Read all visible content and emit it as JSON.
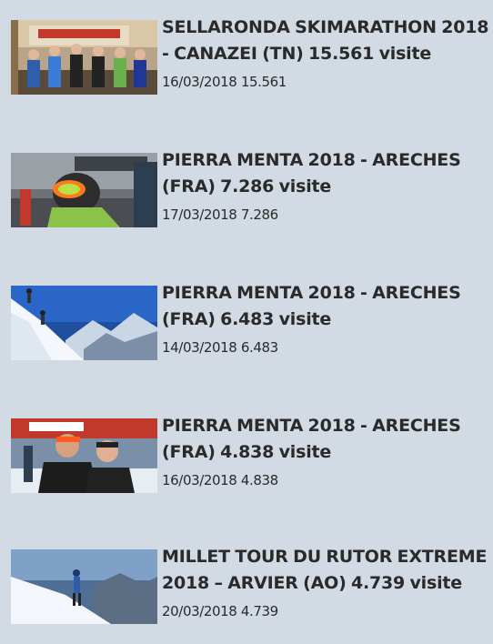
{
  "articles": [
    {
      "title": "SELLARONDA SKIMARATHON 2018 - CANAZEI (TN) 15.561 visite",
      "meta": "16/03/2018 15.561"
    },
    {
      "title": "PIERRA MENTA 2018 - ARECHES (FRA) 7.286 visite",
      "meta": "17/03/2018 7.286"
    },
    {
      "title": "PIERRA MENTA 2018 - ARECHES (FRA) 6.483 visite",
      "meta": "14/03/2018 6.483"
    },
    {
      "title": "PIERRA MENTA 2018 - ARECHES (FRA) 4.838 visite",
      "meta": "16/03/2018 4.838"
    },
    {
      "title": "MILLET TOUR DU RUTOR EXTREME 2018 – ARVIER (AO) 4.739 visite",
      "meta": "20/03/2018 4.739"
    }
  ],
  "colors": {
    "background": "#d2dae3",
    "text": "#2a2a2a"
  }
}
